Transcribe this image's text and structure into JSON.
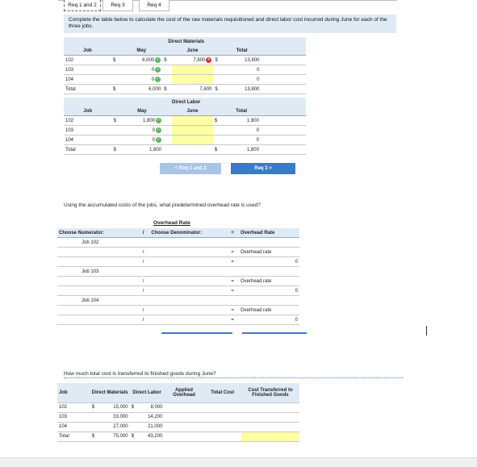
{
  "tabs": [
    {
      "label": "Req 1 and 2",
      "active": true
    },
    {
      "label": "Req 3",
      "active": false
    },
    {
      "label": "Req 4",
      "active": false
    }
  ],
  "instruction": "Complete the table below to calculate the cost of the raw materials requisitioned and direct labor cost incurred during June for each of the three jobs.",
  "direct_materials": {
    "title": "Direct Materials",
    "headers": {
      "job": "Job",
      "may": "May",
      "june": "June",
      "total": "Total"
    },
    "rows": [
      {
        "job": "102",
        "may_dollar": "$",
        "may": "6,000",
        "june_dollar": "$",
        "june": "7,800",
        "total_dollar": "$",
        "total": "13,800"
      },
      {
        "job": "103",
        "may_dollar": "",
        "may": "0",
        "june_dollar": "",
        "june": "",
        "total_dollar": "",
        "total": "0"
      },
      {
        "job": "104",
        "may_dollar": "",
        "may": "0",
        "june_dollar": "",
        "june": "",
        "total_dollar": "",
        "total": "0"
      },
      {
        "job": "Total",
        "may_dollar": "$",
        "may": "6,000",
        "june_dollar": "$",
        "june": "7,800",
        "total_dollar": "$",
        "total": "13,800"
      }
    ]
  },
  "direct_labor": {
    "title": "Direct Labor",
    "headers": {
      "job": "Job",
      "may": "May",
      "june": "June",
      "total": "Total"
    },
    "rows": [
      {
        "job": "102",
        "may_dollar": "$",
        "may": "1,800",
        "june_dollar": "",
        "june": "",
        "total_dollar": "$",
        "total": "1,800"
      },
      {
        "job": "103",
        "may_dollar": "",
        "may": "0",
        "june_dollar": "",
        "june": "",
        "total_dollar": "",
        "total": "0"
      },
      {
        "job": "104",
        "may_dollar": "",
        "may": "0",
        "june_dollar": "",
        "june": "",
        "total_dollar": "",
        "total": "0"
      },
      {
        "job": "Total",
        "may_dollar": "$",
        "may": "1,800",
        "june_dollar": "",
        "june": "",
        "total_dollar": "$",
        "total": "1,800"
      }
    ]
  },
  "nav": {
    "prev": "< Req 1 and 2",
    "next": "Req 3 >"
  },
  "question2": "Using the accumulated costs of the jobs, what predetermined overhead rate is used?",
  "overhead": {
    "title": "Overhead Rate",
    "numerator_label": "Choose Numerator:",
    "slash": "/",
    "denominator_label": "Choose Denominator:",
    "equals": "=",
    "result_label": "Overhead Rate",
    "jobs": [
      {
        "name": "Job 102",
        "rate_label": "Overhead rate",
        "value": "0"
      },
      {
        "name": "Job 103",
        "rate_label": "Overhead rate",
        "value": "0"
      },
      {
        "name": "Job 104",
        "rate_label": "Overhead rate",
        "value": "0"
      }
    ]
  },
  "question3": "How much total cost is transferred to finished goods during June?",
  "finished": {
    "headers": {
      "job": "Job",
      "dm": "Direct Materials",
      "dl": "Direct Labor",
      "applied": "Applied Overhead",
      "total": "Total Cost",
      "transferred": "Cost Transferred to Finished Goods"
    },
    "rows": [
      {
        "job": "102",
        "dm_dollar": "$",
        "dm": "15,000",
        "dl_dollar": "$",
        "dl": "8,000"
      },
      {
        "job": "103",
        "dm_dollar": "",
        "dm": "33,000",
        "dl_dollar": "",
        "dl": "14,200"
      },
      {
        "job": "104",
        "dm_dollar": "",
        "dm": "27,000",
        "dl_dollar": "",
        "dl": "21,000"
      },
      {
        "job": "Total",
        "dm_dollar": "$",
        "dm": "75,000",
        "dl_dollar": "$",
        "dl": "43,200"
      }
    ]
  },
  "colors": {
    "accent": "#3a7bc8",
    "header_bg": "#dfeaf5",
    "input_bg": "#ffffa6",
    "correct": "#5cb85c",
    "wrong": "#d9302c"
  }
}
